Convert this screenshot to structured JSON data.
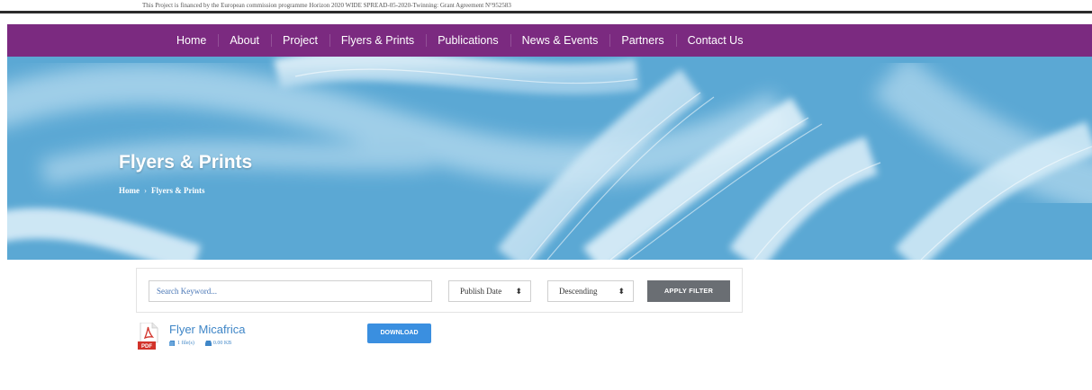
{
  "topbar": {
    "notice": "This Project is financed by the European commission programme Horizon 2020 WIDE SPREAD-05-2020-Twinning: Grant Agreement N°952583"
  },
  "nav": {
    "items": [
      "Home",
      "About",
      "Project",
      "Flyers & Prints",
      "Publications",
      "News & Events",
      "Partners",
      "Contact Us"
    ]
  },
  "hero": {
    "title": "Flyers & Prints",
    "breadcrumb": {
      "home": "Home",
      "separator": "›",
      "current": "Flyers & Prints"
    }
  },
  "filter": {
    "search_placeholder": "Search Keyword...",
    "sort_by": "Publish Date",
    "order": "Descending",
    "apply_label": "APPLY FILTER"
  },
  "documents": [
    {
      "icon": "pdf-icon",
      "icon_badge": "PDF",
      "title": "Flyer Micafrica",
      "files": "1 file(s)",
      "size": "0.00 KB",
      "download_label": "DOWNLOAD"
    }
  ],
  "colors": {
    "nav_bg": "#7b2a80",
    "hero_bg": "#5aa7d3",
    "apply_bg": "#6a6e73",
    "download_bg": "#3a8fe0",
    "link": "#3f86c7",
    "pdf_red": "#d2332a"
  }
}
